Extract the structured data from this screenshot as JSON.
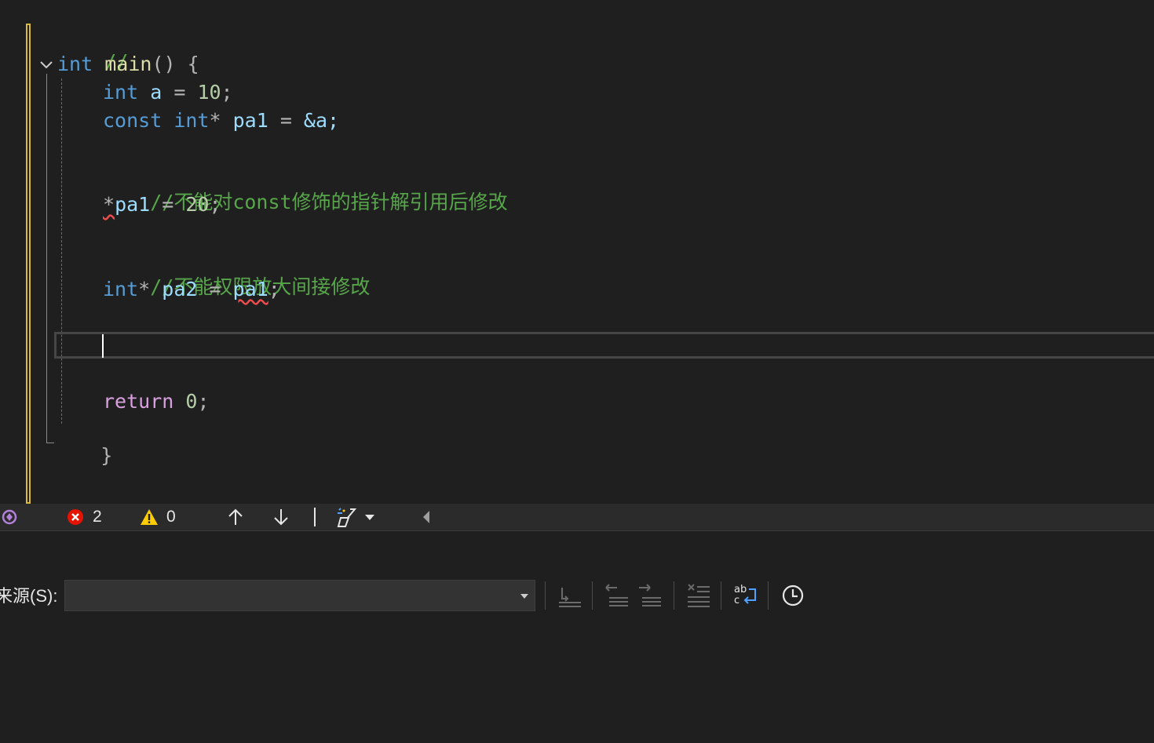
{
  "code_lines": {
    "l1": "//",
    "l2_kw": "int",
    "l2_fn": "main",
    "l2_rest": "() {",
    "l3_kw": "int",
    "l3_var": "a",
    "l3_op": " = ",
    "l3_num": "10",
    "l3_end": ";",
    "l4_kw1": "const",
    "l4_kw2": "int",
    "l4_star": "*",
    "l4_var": "pa1",
    "l4_op": " = ",
    "l4_rest": "&a;",
    "l5_comment": "//不能对const修饰的指针解引用后修改",
    "l6_star": "*",
    "l6_var": "pa1",
    "l6_op": " = ",
    "l6_num": "20",
    "l6_end": ";",
    "l7_comment": "//不能权限放大间接修改",
    "l8_kw": "int",
    "l8_star": "*",
    "l8_var": "pa2",
    "l8_op": " = ",
    "l8_var2": "pa1",
    "l8_end": ";",
    "l9_kw": "return",
    "l9_num": "0",
    "l9_end": ";",
    "l10": "}"
  },
  "statusbar": {
    "error_count": "2",
    "warning_count": "0"
  },
  "output": {
    "source_label": "来源(S):",
    "source_value": ""
  },
  "icons": [
    "intellicode-icon",
    "error-icon",
    "warning-icon",
    "arrow-up-icon",
    "arrow-down-icon",
    "cleanup-brush-icon",
    "dropdown-caret-icon",
    "scroll-left-icon",
    "goto-line-icon",
    "find-previous-icon",
    "find-next-icon",
    "clear-all-icon",
    "toggle-word-wrap-icon",
    "show-timestamps-icon"
  ],
  "colors": {
    "keyword": "#569cd6",
    "control_keyword": "#d8a0df",
    "number": "#b5cea8",
    "variable": "#9cdcfe",
    "function": "#dcdcaa",
    "comment": "#57a64a",
    "error": "#e51400",
    "warning": "#ffcc00",
    "change_bar": "#d7ba3d"
  }
}
